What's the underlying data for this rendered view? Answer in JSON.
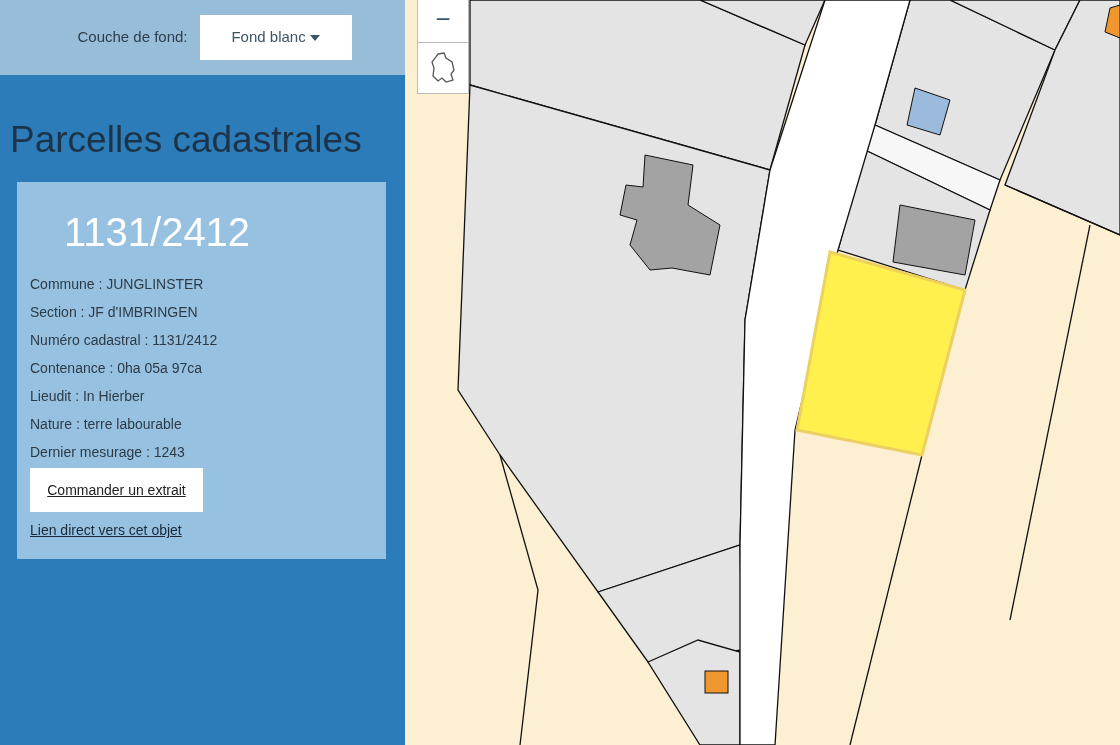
{
  "layer_selector": {
    "label": "Couche de fond:",
    "value": "Fond blanc"
  },
  "panel": {
    "title": "Parcelles cadastrales"
  },
  "parcel": {
    "number": "1131/2412",
    "attributes": [
      "Commune : JUNGLINSTER",
      "Section : JF d'IMBRINGEN",
      "Numéro cadastral : 1131/2412",
      "Contenance : 0ha 05a 97ca",
      "Lieudit : In Hierber",
      "Nature : terre labourable",
      "Dernier mesurage : 1243"
    ],
    "order_button": "Commander un extrait",
    "direct_link": "Lien direct vers cet objet"
  },
  "map": {
    "zoom_out": "−"
  }
}
